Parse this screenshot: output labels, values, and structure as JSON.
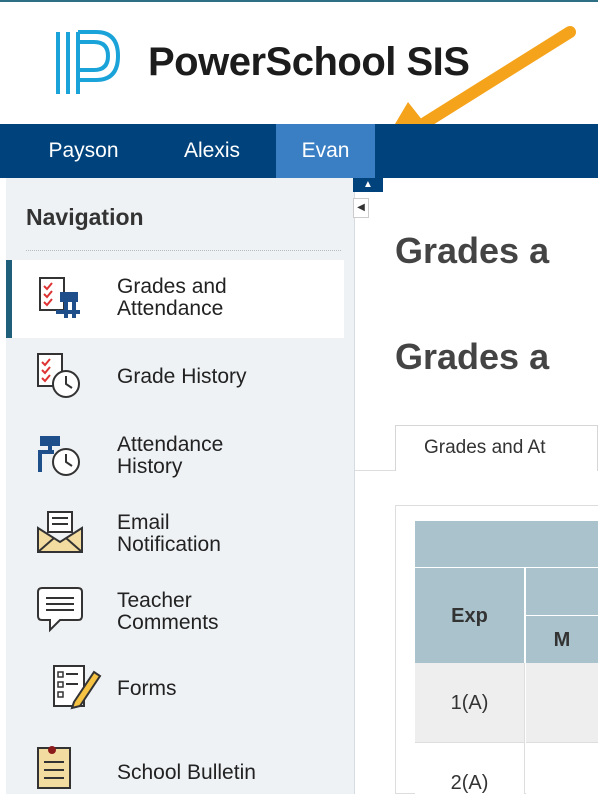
{
  "app": {
    "logo_text": "PowerSchool SIS",
    "brand_color": "#00427c",
    "accent_color": "#3a7fc4",
    "arrow_color": "#f5a31a"
  },
  "students": [
    {
      "name": "Payson",
      "active": false
    },
    {
      "name": "Alexis",
      "active": false
    },
    {
      "name": "Evan",
      "active": true
    }
  ],
  "sidebar": {
    "title": "Navigation",
    "items": [
      {
        "label": "Grades and\nAttendance",
        "icon": "grades-attendance-icon",
        "active": true
      },
      {
        "label": "Grade History",
        "icon": "grade-history-icon",
        "active": false
      },
      {
        "label": "Attendance\nHistory",
        "icon": "attendance-history-icon",
        "active": false
      },
      {
        "label": "Email\nNotification",
        "icon": "email-envelope-icon",
        "active": false
      },
      {
        "label": "Teacher\nComments",
        "icon": "speech-bubble-icon",
        "active": false
      },
      {
        "label": "Forms",
        "icon": "forms-pencil-icon",
        "active": false
      },
      {
        "label": "School Bulletin",
        "icon": "bulletin-board-icon",
        "active": false
      }
    ]
  },
  "main": {
    "heading1": "Grades a",
    "heading2": "Grades a",
    "tab_label": "Grades and At"
  },
  "grid": {
    "col_exp": "Exp",
    "col_m": "M",
    "rows": [
      "1(A)",
      "2(A)"
    ]
  }
}
